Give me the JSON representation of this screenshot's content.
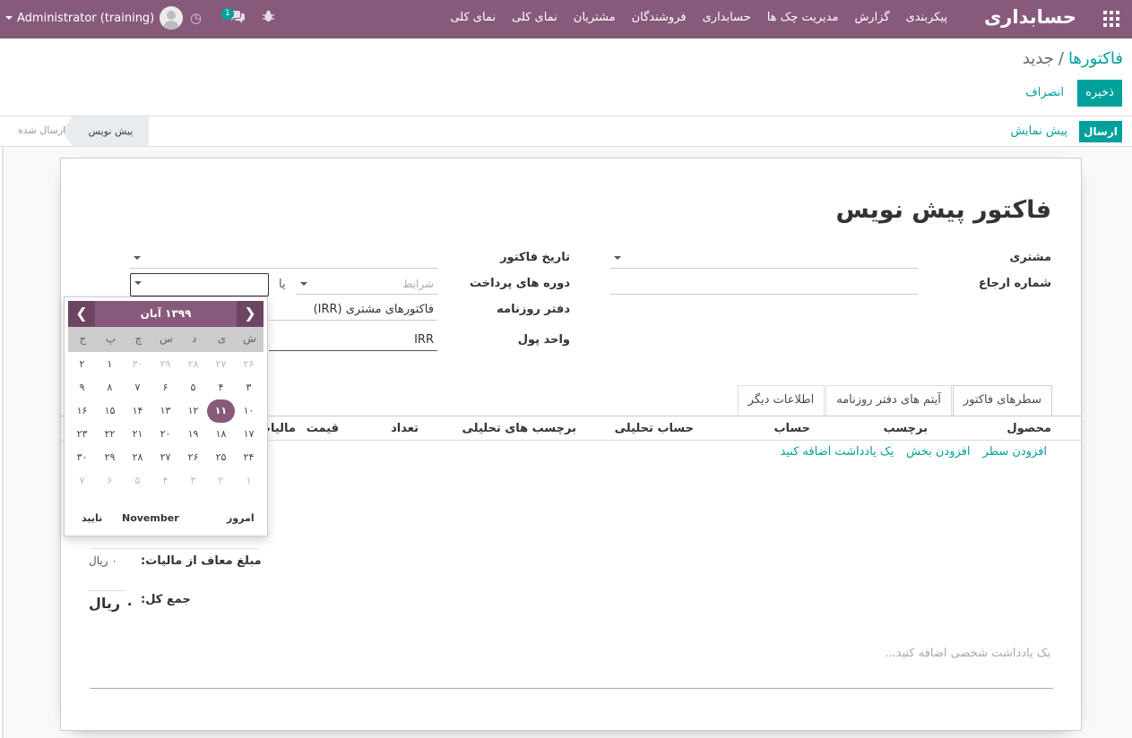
{
  "navbar": {
    "brand": "حسابداری",
    "menu": [
      "نمای کلی",
      "نمای کلی",
      "مشتریان",
      "فروشندگان",
      "حسابداری",
      "مدیریت چک ها",
      "گزارش",
      "پیکربندی"
    ],
    "user": "Administrator (training)",
    "messages_count": "1",
    "icons": [
      "apps-icon",
      "bug-icon",
      "chat-icon",
      "clock-icon"
    ]
  },
  "breadcrumb": {
    "parent": "فاکتورها",
    "separator": "/",
    "current": "جدید"
  },
  "actions": {
    "save": "ذخیره",
    "discard": "انصراف"
  },
  "statusbar": {
    "send": "ارسال",
    "preview": "پیش نمایش",
    "stage_draft": "پیش نویس",
    "stage_sent": "ارسال شده"
  },
  "form": {
    "title": "فاکتور پیش نویس",
    "customer_label": "مشتری",
    "reference_label": "شماره ارجاع",
    "invoice_date_label": "تاریخ فاکتور",
    "payment_term_label": "دوره های پرداخت",
    "payment_term_placeholder": "شرایط",
    "or_text": "یا",
    "journal_label": "دفتر روزنامه",
    "journal_value": "فاکتورهای مشتری (IRR)",
    "currency_label": "واحد پول",
    "currency_value": "IRR"
  },
  "tabs": [
    "سطرهای فاکتور",
    "آیتم های دفتر روزنامه",
    "اطلاعات دیگر"
  ],
  "lines_table": {
    "columns": [
      "محصول",
      "برچسب",
      "حساب",
      "حساب تحلیلی",
      "برچسب های تحلیلی",
      "تعداد",
      "قیمت",
      "مالیات"
    ],
    "add_line": "افزودن سطر",
    "add_section": "افزودن بخش",
    "add_note": "یک یادداشت اضافه کنید"
  },
  "totals": {
    "untaxed_label": "مبلغ معاف از مالیات:",
    "untaxed_value": "۰ ریال",
    "total_label": "جمع کل:",
    "total_value": "۰ ریال"
  },
  "narration_placeholder": "یک یادداشت شخصی اضافه کنید...",
  "datepicker": {
    "month": "۱۳۹۹ آبان",
    "prev_icon": "chevron-left-icon",
    "next_icon": "chevron-right-icon",
    "weekdays": [
      "ش",
      "ی",
      "د",
      "س",
      "چ",
      "پ",
      "ج"
    ],
    "weeks": [
      [
        "۲۶",
        "۲۷",
        "۲۸",
        "۲۹",
        "۳۰",
        "۱",
        "۲"
      ],
      [
        "۳",
        "۴",
        "۵",
        "۶",
        "۷",
        "۸",
        "۹"
      ],
      [
        "۱۰",
        "۱۱",
        "۱۲",
        "۱۳",
        "۱۴",
        "۱۵",
        "۱۶"
      ],
      [
        "۱۷",
        "۱۸",
        "۱۹",
        "۲۰",
        "۲۱",
        "۲۲",
        "۲۳"
      ],
      [
        "۲۴",
        "۲۵",
        "۲۶",
        "۲۷",
        "۲۸",
        "۲۹",
        "۳۰"
      ],
      [
        "۱",
        "۲",
        "۳",
        "۴",
        "۵",
        "۶",
        "۷"
      ]
    ],
    "selected_day": "۱۱",
    "today": "امروز",
    "gregorian_month": "November",
    "confirm": "تایید"
  },
  "colors": {
    "primary": "#875a7b",
    "accent": "#00a09d"
  }
}
